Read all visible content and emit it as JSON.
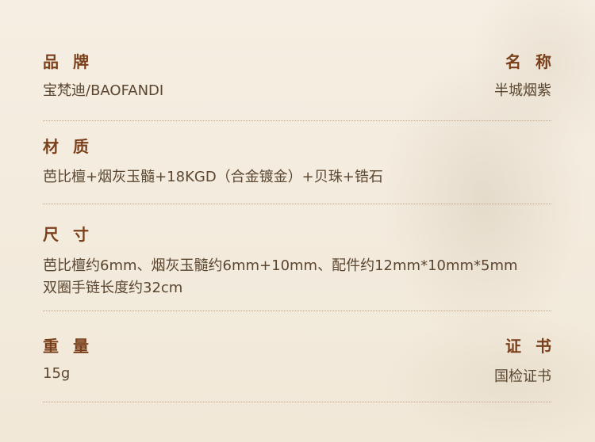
{
  "brand": {
    "label": "品牌",
    "value": "宝梵迪/BAOFANDI"
  },
  "name": {
    "label": "名称",
    "value": "半城烟紫"
  },
  "material": {
    "label": "材质",
    "value": "芭比檀+烟灰玉髓+18KGD（合金镀金）+贝珠+锆石"
  },
  "size": {
    "label": "尺寸",
    "lines": [
      "芭比檀约6mm、烟灰玉髓约6mm+10mm、配件约12mm*10mm*5mm",
      "双圈手链长度约32cm"
    ]
  },
  "weight": {
    "label": "重量",
    "value": "15g"
  },
  "certificate": {
    "label": "证书",
    "value": "国检证书"
  }
}
